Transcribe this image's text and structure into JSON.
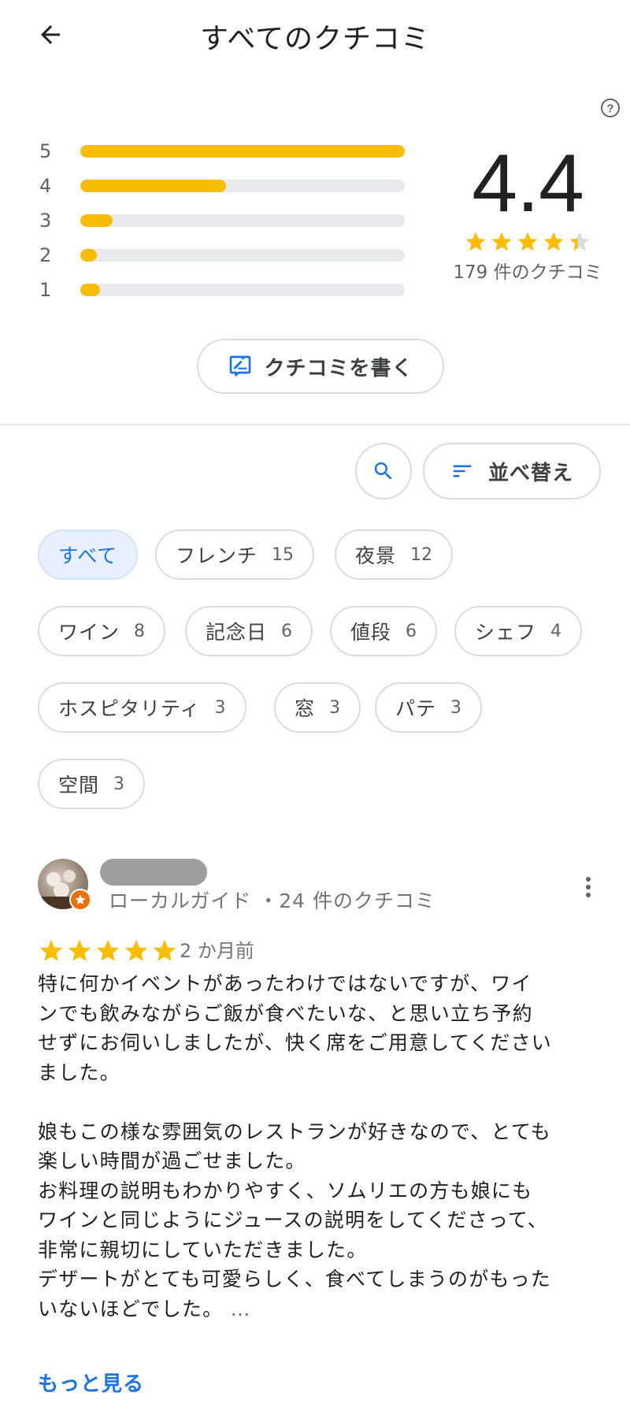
{
  "header": {
    "title": "すべてのクチコミ"
  },
  "colors": {
    "accent": "#1a73e8",
    "star": "#fbbc04",
    "track": "#e8eaed",
    "chip_active_bg": "#e8f0fe"
  },
  "histogram": [
    {
      "label": "5",
      "fraction": 1.0
    },
    {
      "label": "4",
      "fraction": 0.45
    },
    {
      "label": "3",
      "fraction": 0.1
    },
    {
      "label": "2",
      "fraction": 0.05
    },
    {
      "label": "1",
      "fraction": 0.06
    }
  ],
  "summary": {
    "score": "4.4",
    "stars": 4.4,
    "count_text": "179 件のクチコミ"
  },
  "actions": {
    "write_review": "クチコミを書く",
    "sort": "並べ替え"
  },
  "icons": {
    "back": "back-arrow-icon",
    "help": "help-icon",
    "write": "write-review-icon",
    "search": "search-icon",
    "sort": "sort-icon",
    "more": "more-vert-icon"
  },
  "chips": [
    {
      "label": "すべて",
      "count": "",
      "active": true
    },
    {
      "label": "フレンチ",
      "count": "15"
    },
    {
      "label": "夜景",
      "count": "12"
    },
    {
      "label": "ワイン",
      "count": "8"
    },
    {
      "label": "記念日",
      "count": "6"
    },
    {
      "label": "値段",
      "count": "6"
    },
    {
      "label": "シェフ",
      "count": "4"
    },
    {
      "label": "ホスピタリティ",
      "count": "3"
    },
    {
      "label": "窓",
      "count": "3"
    },
    {
      "label": "パテ",
      "count": "3"
    },
    {
      "label": "空間",
      "count": "3"
    }
  ],
  "review": {
    "meta": "ローカルガイド ・24 件のクチコミ",
    "rating": 5,
    "time": "2 か月前",
    "lines": [
      "特に何かイベントがあったわけではないですが、ワイ",
      "ンでも飲みながらご飯が食べたいな、と思い立ち予約",
      "せずにお伺いしましたが、快く席をご用意してください",
      "ました。",
      "",
      "娘もこの様な雰囲気のレストランが好きなので、とても",
      "楽しい時間が過ごせました。",
      "お料理の説明もわかりやすく、ソムリエの方も娘にも",
      "ワインと同じようにジュースの説明をしてくださって、",
      "非常に親切にしていただきました。",
      "デザートがとても可愛らしく、食べてしまうのがもった",
      "いないほどでした。"
    ],
    "ellipsis": "…",
    "more_link": "もっと見る"
  }
}
